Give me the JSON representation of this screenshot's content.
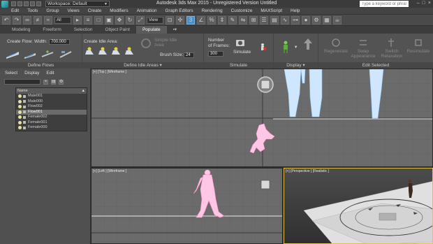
{
  "app": {
    "title": "Autodesk 3ds Max  2015   -  Unregistered Version    Untitled",
    "workspace": "Workspace: Default",
    "search_placeholder": "Type a keyword or phrase"
  },
  "menu": [
    "Edit",
    "Tools",
    "Group",
    "Views",
    "Create",
    "Modifiers",
    "Animation",
    "Graph Editors",
    "Rendering",
    "Customize",
    "MAXScript",
    "Help"
  ],
  "toolbar": {
    "selection_filter": "All",
    "ref_coord": "View"
  },
  "ribbon": {
    "tabs": [
      "Modeling",
      "Freeform",
      "Selection",
      "Object Paint",
      "Populate"
    ],
    "active_tab": "Populate",
    "define_flows": {
      "create_flow_label": "Create Flow:",
      "width_label": "Width:",
      "width_value": "700.000",
      "footer": "Define Flows"
    },
    "define_idle": {
      "create_idle_label": "Create Idle Area:",
      "simple_idle_label": "Simple Idle Area",
      "brush_size_label": "Brush Size:",
      "brush_size_value": "24",
      "footer": "Define Idle Areas"
    },
    "simulate": {
      "frames_label_1": "Number",
      "frames_label_2": "of Frames:",
      "frames_value": "300",
      "simulate_label": "Simulate",
      "footer": "Simulate"
    },
    "display": {
      "footer": "Display"
    },
    "edit_selected": {
      "buttons": [
        "Regenerate",
        "Swap Appearance",
        "Switch Relaxation",
        "Resimulate"
      ],
      "footer": "Edit Selected"
    }
  },
  "scene_explorer": {
    "menu": [
      "Select",
      "Display",
      "Edit"
    ],
    "column": "Name",
    "sort_indicator": "▲",
    "items": [
      {
        "name": "Male001",
        "selected": false
      },
      {
        "name": "Male000",
        "selected": false
      },
      {
        "name": "Flow002",
        "selected": false
      },
      {
        "name": "Flow001",
        "selected": true
      },
      {
        "name": "Female002",
        "selected": false
      },
      {
        "name": "Female001",
        "selected": false
      },
      {
        "name": "Female000",
        "selected": false
      }
    ]
  },
  "viewports": {
    "top": "[+] [Top ] [Wireframe ]",
    "left": "[+] [Left ] [Wireframe ]",
    "perspective": "[+] [Perspective ] [Realistic ]"
  },
  "colors": {
    "wire_blue": "#a8d4ff",
    "wire_pink": "#ff9fd4",
    "active_viewport_border": "#e3c04a",
    "accent_tab": "#5b5b5b"
  }
}
